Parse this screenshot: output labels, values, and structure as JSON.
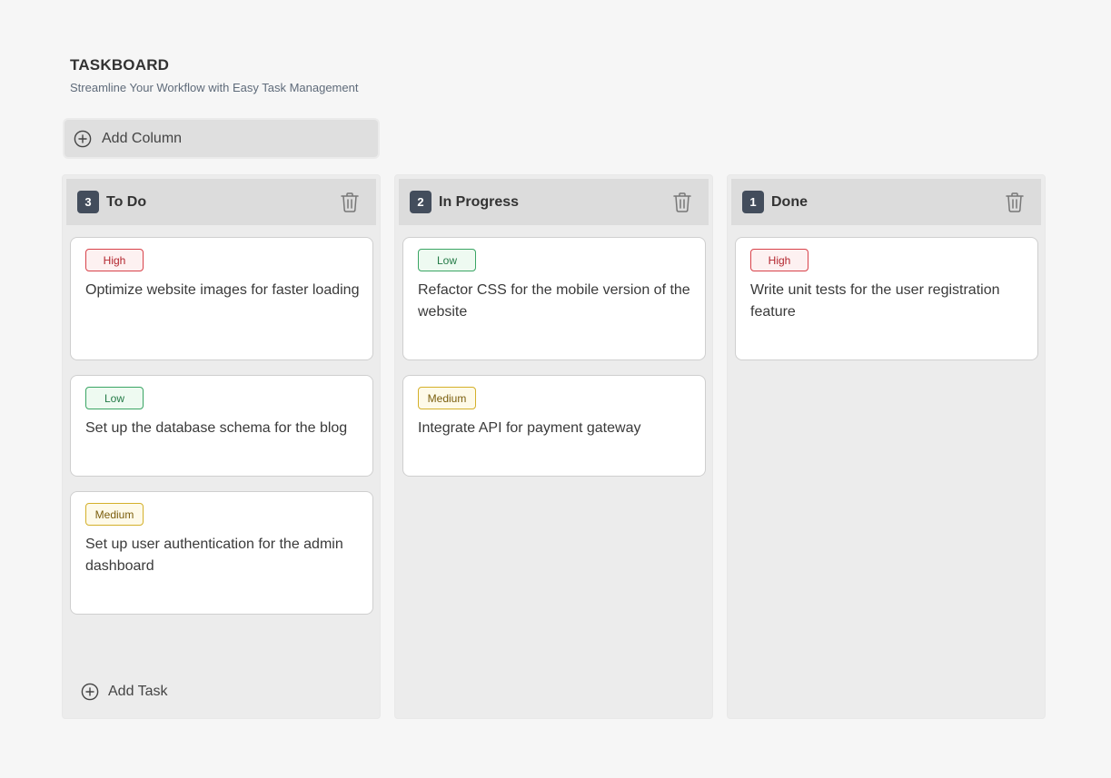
{
  "header": {
    "title": "TASKBOARD",
    "subtitle": "Streamline Your Workflow with Easy Task Management"
  },
  "toolbar": {
    "add_column_label": "Add Column",
    "add_column_icon": "plus-circle-icon"
  },
  "columns": [
    {
      "title": "To Do",
      "count": "3",
      "delete_icon": "trash-icon",
      "cards": [
        {
          "priority": "High",
          "text": "Optimize website images for faster loading"
        },
        {
          "priority": "Low",
          "text": "Set up the database schema for the blog"
        },
        {
          "priority": "Medium",
          "text": "Set up user authentication for the admin dashboard"
        }
      ],
      "add_task_label": "Add Task"
    },
    {
      "title": "In Progress",
      "count": "2",
      "delete_icon": "trash-icon",
      "cards": [
        {
          "priority": "Low",
          "text": "Refactor CSS for the mobile version of the website"
        },
        {
          "priority": "Medium",
          "text": "Integrate API for payment gateway"
        }
      ]
    },
    {
      "title": "Done",
      "count": "1",
      "delete_icon": "trash-icon",
      "cards": [
        {
          "priority": "High",
          "text": "Write unit tests for the user registration feature"
        }
      ]
    }
  ],
  "colors": {
    "background": "#f6f6f6",
    "column": "#ececec",
    "column_header": "#dcdcdc",
    "badge": "#434d5c",
    "high": "#d8424a",
    "low": "#3aa564",
    "medium": "#d4b02a"
  }
}
